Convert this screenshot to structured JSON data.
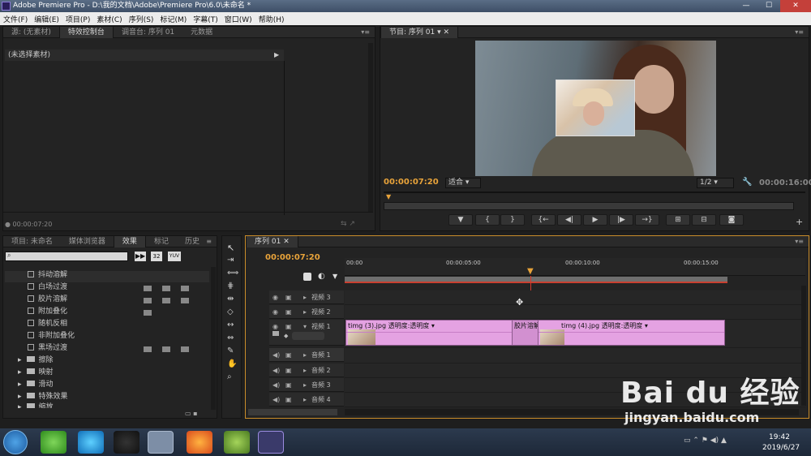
{
  "window": {
    "title": "Adobe Premiere Pro - D:\\我的文档\\Adobe\\Premiere Pro\\6.0\\未命名 *",
    "minimize": "—",
    "maximize": "☐",
    "close": "✕"
  },
  "menu": [
    "文件(F)",
    "编辑(E)",
    "项目(P)",
    "素材(C)",
    "序列(S)",
    "标记(M)",
    "字幕(T)",
    "窗口(W)",
    "帮助(H)"
  ],
  "source_panel": {
    "tabs": [
      "源: (无素材)",
      "特效控制台",
      "调音台: 序列 01",
      "元数据"
    ],
    "active_tab": 1,
    "no_clip_label": "(未选择素材)",
    "timecode": "00:00:07:20"
  },
  "program_monitor": {
    "tab": "节目: 序列 01",
    "timecode": "00:00:07:20",
    "fit": "适合",
    "resolution": "1/2",
    "duration": "00:00:16:00",
    "buttons": [
      "▼",
      "{",
      "}",
      "{←",
      "◀|",
      "▶",
      "|▶",
      "→}",
      "⊞",
      "⊟",
      "◙"
    ]
  },
  "project_panel": {
    "tabs": [
      "项目: 未命名",
      "媒体浏览器",
      "效果",
      "标记",
      "历史"
    ],
    "active_tab": 2,
    "icon_labels": [
      "32",
      "YUV"
    ],
    "effects": [
      "抖动溶解",
      "白场过渡",
      "胶片溶解",
      "附加叠化",
      "随机反相",
      "非附加叠化",
      "黑场过渡"
    ],
    "selected_effect": 2,
    "folders": [
      "擦除",
      "映射",
      "滑动",
      "特殊效果",
      "缩放"
    ]
  },
  "timeline": {
    "tab": "序列 01",
    "timecode": "00:00:07:20",
    "ruler": [
      "00:00",
      "00:00:05:00",
      "00:00:10:00",
      "00:00:15:00"
    ],
    "video_tracks": [
      "视频 3",
      "视频 2",
      "视频 1"
    ],
    "audio_tracks": [
      "音频 1",
      "音频 2",
      "音频 3",
      "音频 4"
    ],
    "clips": [
      {
        "name": "timg (3).jpg",
        "effect": "透明度:透明度"
      },
      {
        "name": "timg (4).jpg",
        "effect": "透明度:透明度"
      }
    ],
    "transition": "胶片溶解"
  },
  "taskbar": {
    "time": "19:42",
    "date": "2019/6/27"
  },
  "watermark": {
    "brand": "Bai du 经验",
    "url": "jingyan.baidu.com"
  }
}
